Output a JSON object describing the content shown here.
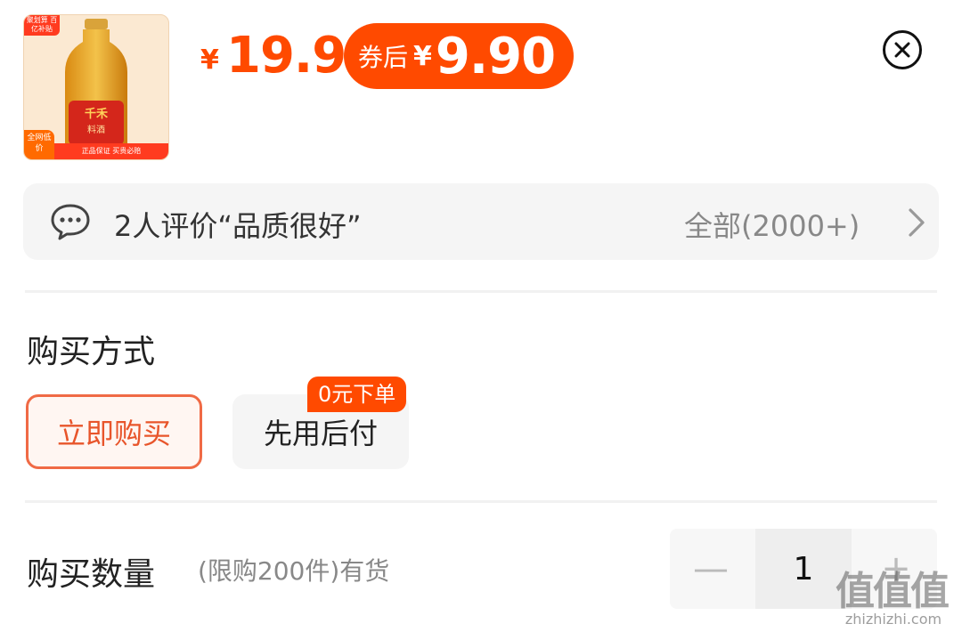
{
  "product": {
    "thumb_tag_top": "聚划算 百亿补贴",
    "thumb_brand": "千禾",
    "thumb_product": "料酒",
    "thumb_tag_corner": "全网低价",
    "thumb_tag_bar": "正品保证  买贵必赔"
  },
  "price": {
    "currency": "¥",
    "original": "19.9",
    "coupon_label": "券后",
    "coupon_currency": "¥",
    "coupon_price": "9.90"
  },
  "review": {
    "text": "2人评价“品质很好”",
    "all_label": "全部(2000+)"
  },
  "purchase_method": {
    "title": "购买方式",
    "options": [
      {
        "label": "立即购买",
        "selected": true
      },
      {
        "label": "先用后付",
        "badge": "0元下单",
        "selected": false
      }
    ]
  },
  "quantity": {
    "title": "购买数量",
    "hint": "(限购200件)有货",
    "minus": "—",
    "value": "1",
    "plus": "+"
  },
  "watermark": {
    "text": "值值值",
    "sub": "zhizhizhi.com"
  },
  "colors": {
    "accent": "#ff4a00",
    "selected_border": "#f06a45"
  },
  "icons": {
    "close": "close-circle-icon",
    "review": "chat-bubble-icon",
    "chevron": "chevron-right-icon"
  }
}
